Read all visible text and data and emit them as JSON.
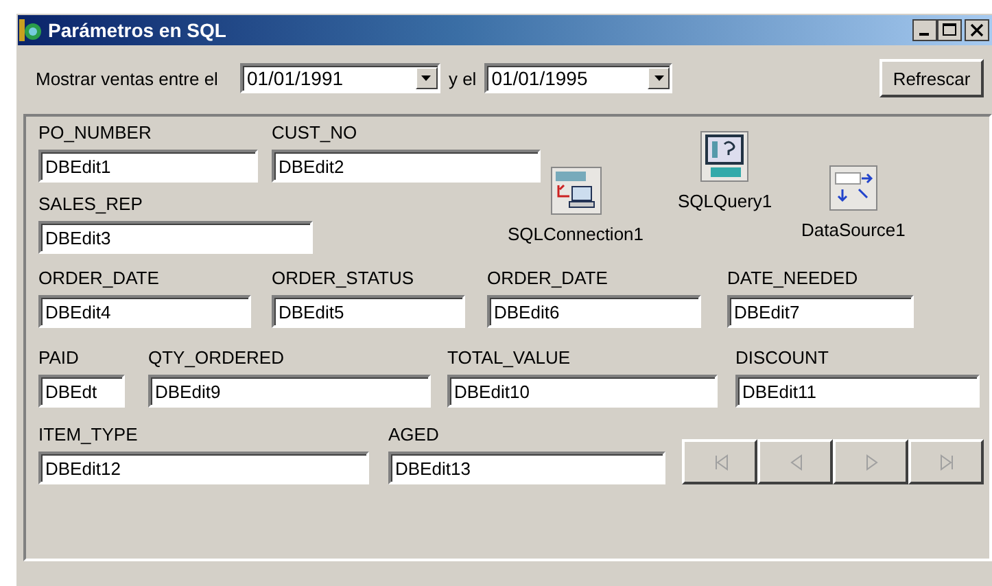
{
  "window": {
    "title": "Parámetros en SQL"
  },
  "filter": {
    "label": "Mostrar ventas entre el",
    "from": {
      "value": "01/01/1991"
    },
    "conjunction": "y el",
    "to": {
      "value": "01/01/1995"
    }
  },
  "refresh_button": "Refrescar",
  "field_rows": [
    [
      {
        "label": "PO_NUMBER",
        "value": "DBEdit1"
      },
      {
        "label": "CUST_NO",
        "value": "DBEdit2"
      }
    ],
    [
      {
        "label": "SALES_REP",
        "value": "DBEdit3"
      }
    ],
    [
      {
        "label": "ORDER_DATE",
        "value": "DBEdit4"
      },
      {
        "label": "ORDER_STATUS",
        "value": "DBEdit5"
      },
      {
        "label": "ORDER_DATE",
        "value": "DBEdit6"
      },
      {
        "label": "DATE_NEEDED",
        "value": "DBEdit7"
      }
    ],
    [
      {
        "label": "PAID",
        "value": "DBEdt"
      },
      {
        "label": "QTY_ORDERED",
        "value": "DBEdit9"
      },
      {
        "label": "TOTAL_VALUE",
        "value": "DBEdit10"
      },
      {
        "label": "DISCOUNT",
        "value": "DBEdit11"
      }
    ],
    [
      {
        "label": "ITEM_TYPE",
        "value": "DBEdit12"
      },
      {
        "label": "AGED",
        "value": "DBEdit13"
      }
    ]
  ],
  "components": [
    {
      "kind": "connection",
      "label": "SQLConnection1"
    },
    {
      "kind": "query",
      "label": "SQLQuery1"
    },
    {
      "kind": "datasource",
      "label": "DataSource1"
    }
  ],
  "navigator": [
    {
      "kind": "first",
      "disabled": true
    },
    {
      "kind": "prior",
      "disabled": true
    },
    {
      "kind": "next",
      "disabled": true
    },
    {
      "kind": "last",
      "disabled": true
    }
  ]
}
